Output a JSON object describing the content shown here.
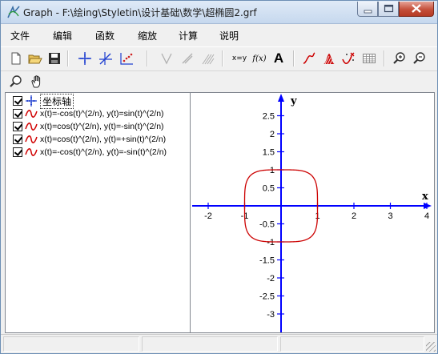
{
  "window": {
    "title": "Graph - F:\\绘ing\\Styletin\\设计基础\\数学\\超椭圆2.grf"
  },
  "menu": [
    "文件",
    "编辑",
    "函数",
    "缩放",
    "计算",
    "说明"
  ],
  "toolbar": {
    "xy_label": "x=y",
    "fx_label": "f(x)",
    "text_label": "A"
  },
  "functions": [
    {
      "label": "坐标轴",
      "checked": true,
      "selected": true,
      "icon": "axes-icon"
    },
    {
      "label": "x(t)=-cos(t)^(2/n), y(t)=sin(t)^(2/n)",
      "checked": true,
      "icon": "curve-icon"
    },
    {
      "label": "x(t)=cos(t)^(2/n), y(t)=-sin(t)^(2/n)",
      "checked": true,
      "icon": "curve-icon"
    },
    {
      "label": "x(t)=cos(t)^(2/n), y(t)=+sin(t)^(2/n)",
      "checked": true,
      "icon": "curve-icon"
    },
    {
      "label": "x(t)=-cos(t)^(2/n), y(t)=-sin(t)^(2/n)",
      "checked": true,
      "icon": "curve-icon"
    }
  ],
  "colors": {
    "axis": "#0000ff",
    "curve": "#cc0000"
  },
  "graph": {
    "x_axis_label": "x",
    "y_axis_label": "y",
    "x_ticks": [
      -2,
      -1,
      1,
      2,
      3,
      4
    ],
    "y_ticks": [
      -3,
      -2.5,
      -2,
      -1.5,
      -1,
      -0.5,
      0.5,
      1,
      1.5,
      2,
      2.5
    ],
    "x_tick_labels": [
      "-2",
      "-1",
      "1",
      "2",
      "3",
      "4"
    ],
    "y_tick_labels": [
      "-3",
      "-2.5",
      "-2",
      "-1.5",
      "-1",
      "-0.5",
      "0.5",
      "1",
      "1.5",
      "2",
      "2.5"
    ],
    "xlim": [
      -2.5,
      4
    ],
    "ylim": [
      -3.4,
      3.1
    ]
  },
  "chart_data": {
    "type": "line",
    "title": "",
    "xlabel": "x",
    "ylabel": "y",
    "curve": "superellipse |x|^n + |y|^n = 1, unit extent",
    "extent": {
      "x": [
        -1,
        1
      ],
      "y": [
        -1,
        1
      ]
    },
    "n": 4
  }
}
